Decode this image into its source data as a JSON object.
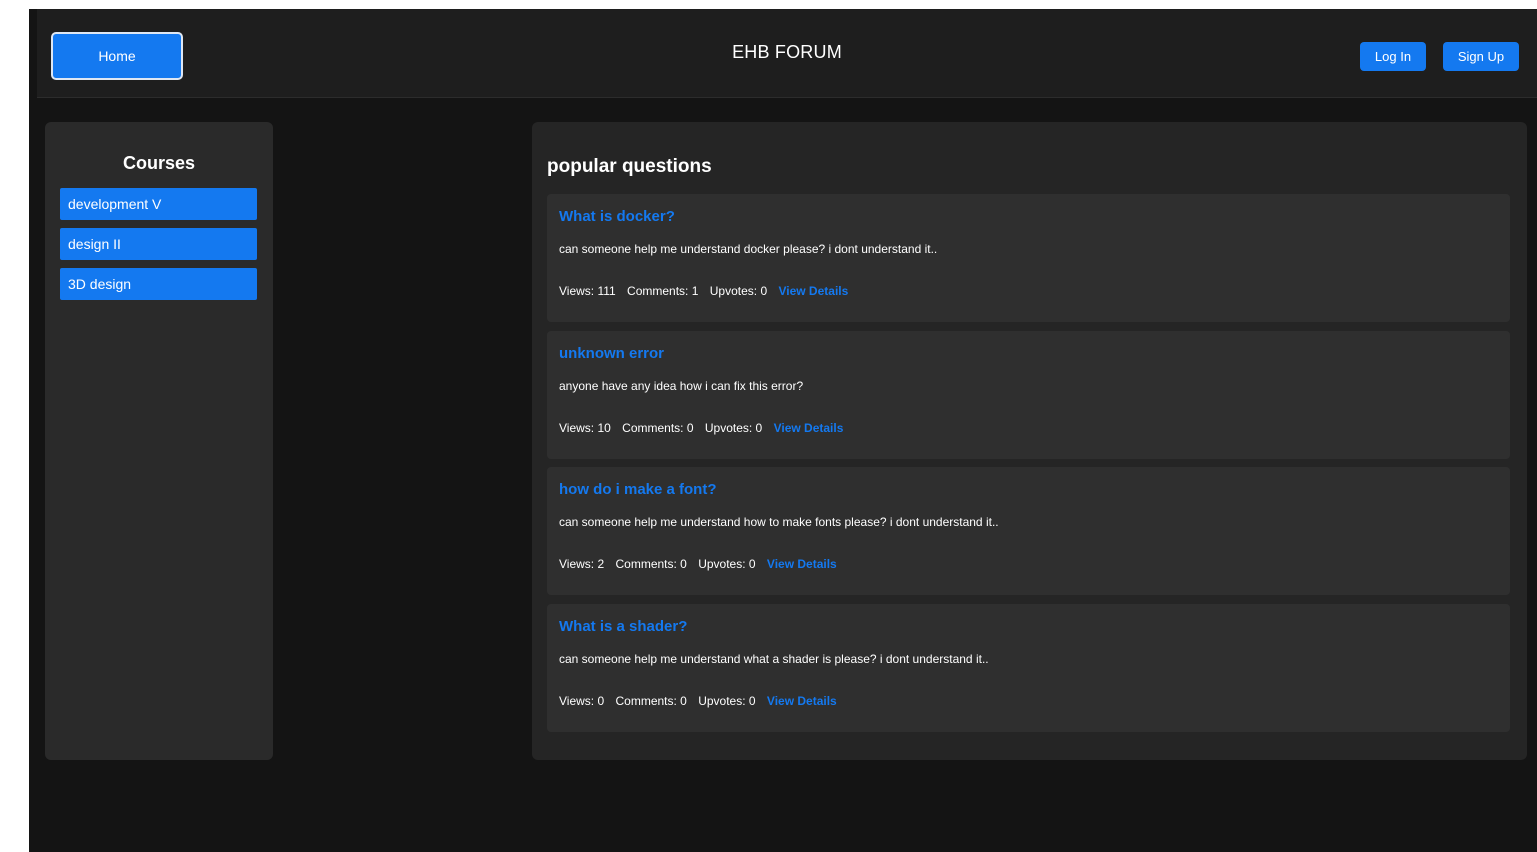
{
  "header": {
    "home_label": "Home",
    "site_title": "EHB FORUM",
    "login_label": "Log In",
    "signup_label": "Sign Up"
  },
  "sidebar": {
    "title": "Courses",
    "items": [
      {
        "label": "development V"
      },
      {
        "label": "design II"
      },
      {
        "label": "3D design"
      }
    ]
  },
  "main": {
    "title": "popular questions",
    "questions": [
      {
        "title": "What is docker?",
        "body": "can someone help me understand docker please? i dont understand it..",
        "views": "Views: 111",
        "comments": "Comments: 1",
        "upvotes": "Upvotes: 0",
        "link": "View Details"
      },
      {
        "title": "unknown error",
        "body": "anyone have any idea how i can fix this error?",
        "views": "Views: 10",
        "comments": "Comments: 0",
        "upvotes": "Upvotes: 0",
        "link": "View Details"
      },
      {
        "title": "how do i make a font?",
        "body": "can someone help me understand how to make fonts please? i dont understand it..",
        "views": "Views: 2",
        "comments": "Comments: 0",
        "upvotes": "Upvotes: 0",
        "link": "View Details"
      },
      {
        "title": "What is a shader?",
        "body": "can someone help me understand what a shader is please? i dont understand it..",
        "views": "Views: 0",
        "comments": "Comments: 0",
        "upvotes": "Upvotes: 0",
        "link": "View Details"
      }
    ]
  },
  "colors": {
    "accent": "#1479f0",
    "background": "#141414",
    "panel": "#252525",
    "card": "#2f2f2f"
  }
}
